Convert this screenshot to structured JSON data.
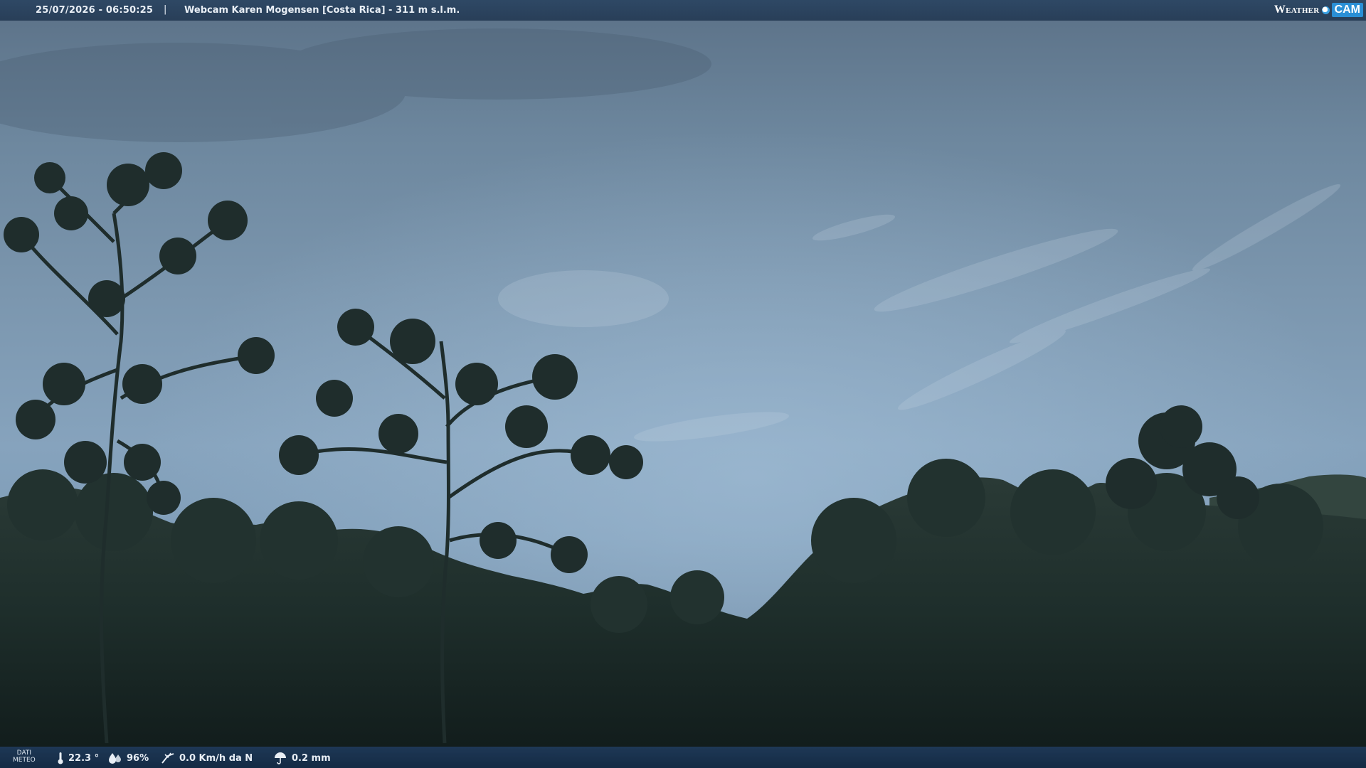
{
  "header": {
    "timestamp": "25/07/2026 - 06:50:25",
    "separator": "|",
    "title": "Webcam Karen Mogensen [Costa Rica]  - 311 m s.l.m.",
    "brand_left": "Weather",
    "brand_right": "CAM"
  },
  "footer": {
    "dati_line1": "DATI",
    "dati_line2": "METEO",
    "temperature": "22.3 °",
    "humidity": "96%",
    "wind": "0.0 Km/h da N",
    "rain": "0.2 mm"
  },
  "icons": {
    "temperature": "thermometer-icon",
    "humidity": "humidity-drop-icon",
    "wind": "wind-icon",
    "rain": "umbrella-icon"
  },
  "colors": {
    "bar_bg": "#2c4663",
    "sky_top": "#5b7187",
    "sky_mid": "#86a3bd",
    "foliage": "#1c2b2a",
    "brand_accent": "#2a8fd6"
  }
}
